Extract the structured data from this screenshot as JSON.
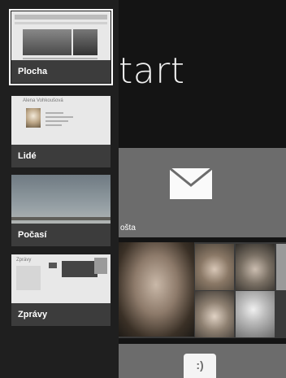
{
  "start_screen": {
    "title": "tart",
    "mail_tile_label": "ošta",
    "bottom_tile_glyph": ":)"
  },
  "switcher": {
    "apps": [
      {
        "label": "Plocha",
        "selected": true
      },
      {
        "label": "Lidé",
        "selected": false,
        "preview_name": "Alena Vohkoušová"
      },
      {
        "label": "Počasí",
        "selected": false
      },
      {
        "label": "Zprávy",
        "selected": false,
        "preview_title": "Zprávy"
      }
    ]
  }
}
